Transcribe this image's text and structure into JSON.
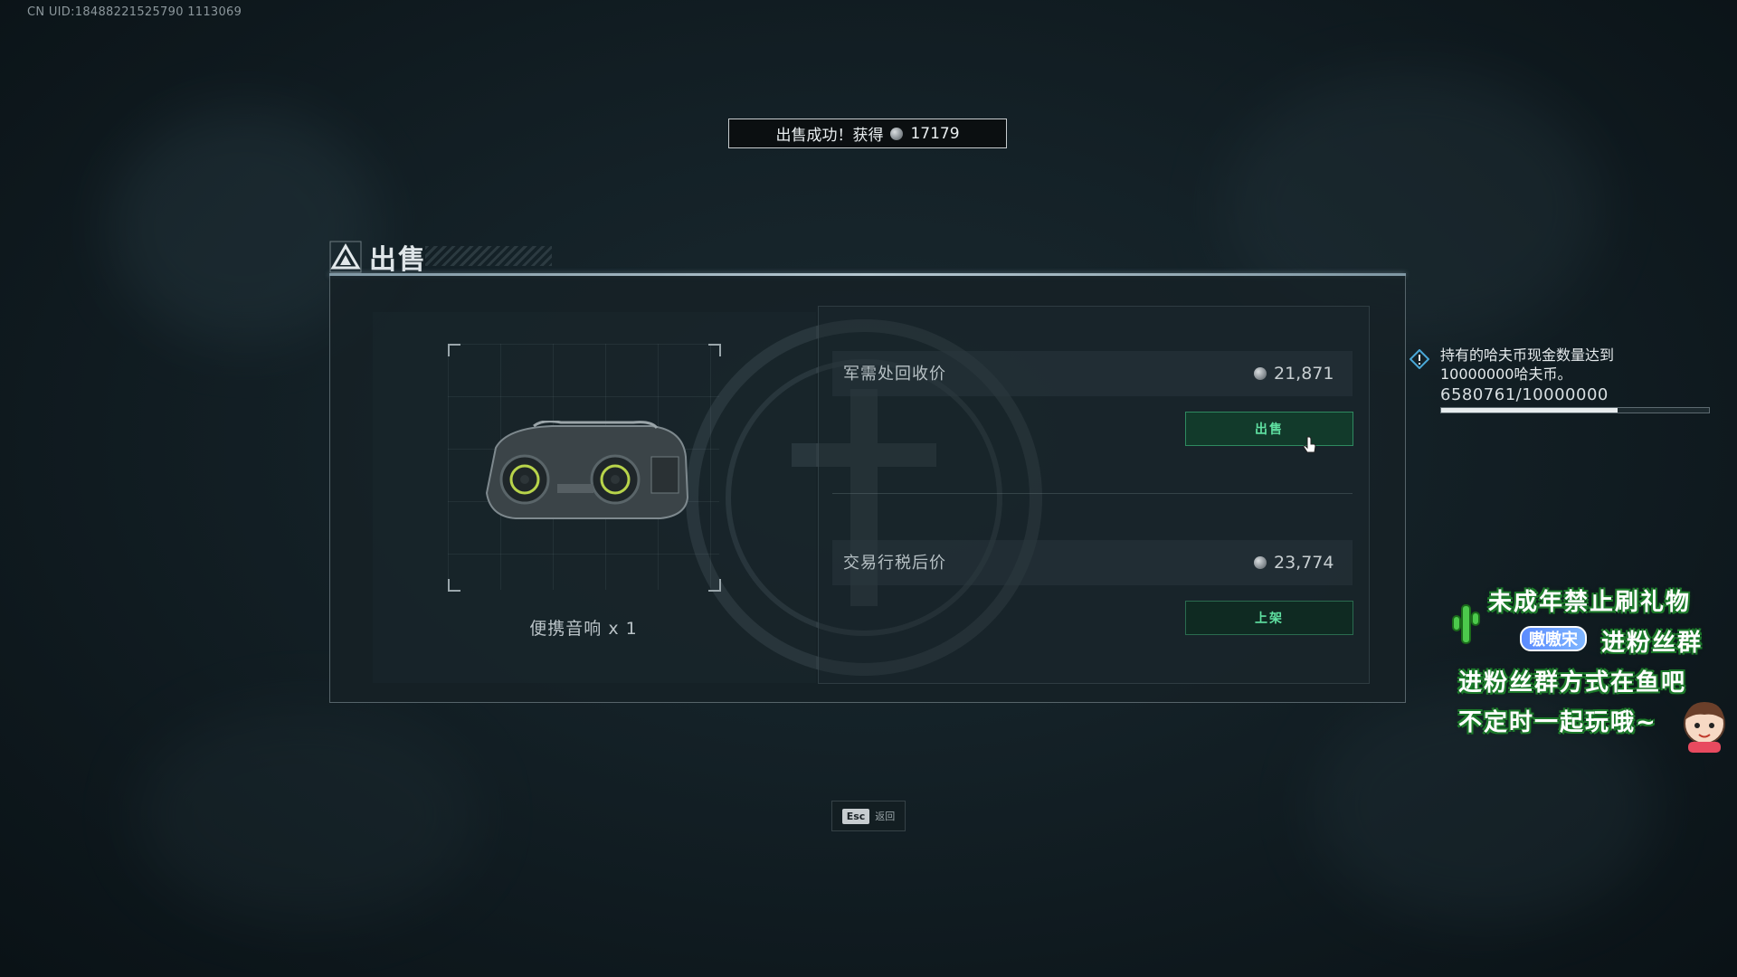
{
  "uid": "CN UID:18488221525790 1113069",
  "toast": {
    "text": "出售成功！获得",
    "amount": "17179"
  },
  "panel": {
    "title": "出售"
  },
  "item": {
    "name": "便携音响 x 1"
  },
  "sell_rows": [
    {
      "label": "军需处回收价",
      "value": "21,871",
      "button": "出售"
    },
    {
      "label": "交易行税后价",
      "value": "23,774",
      "button": "上架"
    }
  ],
  "esc_hint": {
    "key": "Esc",
    "label": "返回"
  },
  "quest": {
    "line1": "持有的哈夫币现金数量达到",
    "line2": "10000000哈夫币。",
    "progress_text": "6580761/10000000",
    "progress_fraction": 0.658
  },
  "stream_overlay": {
    "line1": "未成年禁止刷礼物",
    "badge": "嗷嗷宋",
    "line2_suffix": "进粉丝群",
    "line3": "进粉丝群方式在鱼吧",
    "line4": "不定时一起玩哦~"
  },
  "colors": {
    "accent_green": "#5fe0a1",
    "button_bg": "#123a2b",
    "panel_bg": "#16212a",
    "overlay_stroke": "#1c7a2a"
  }
}
